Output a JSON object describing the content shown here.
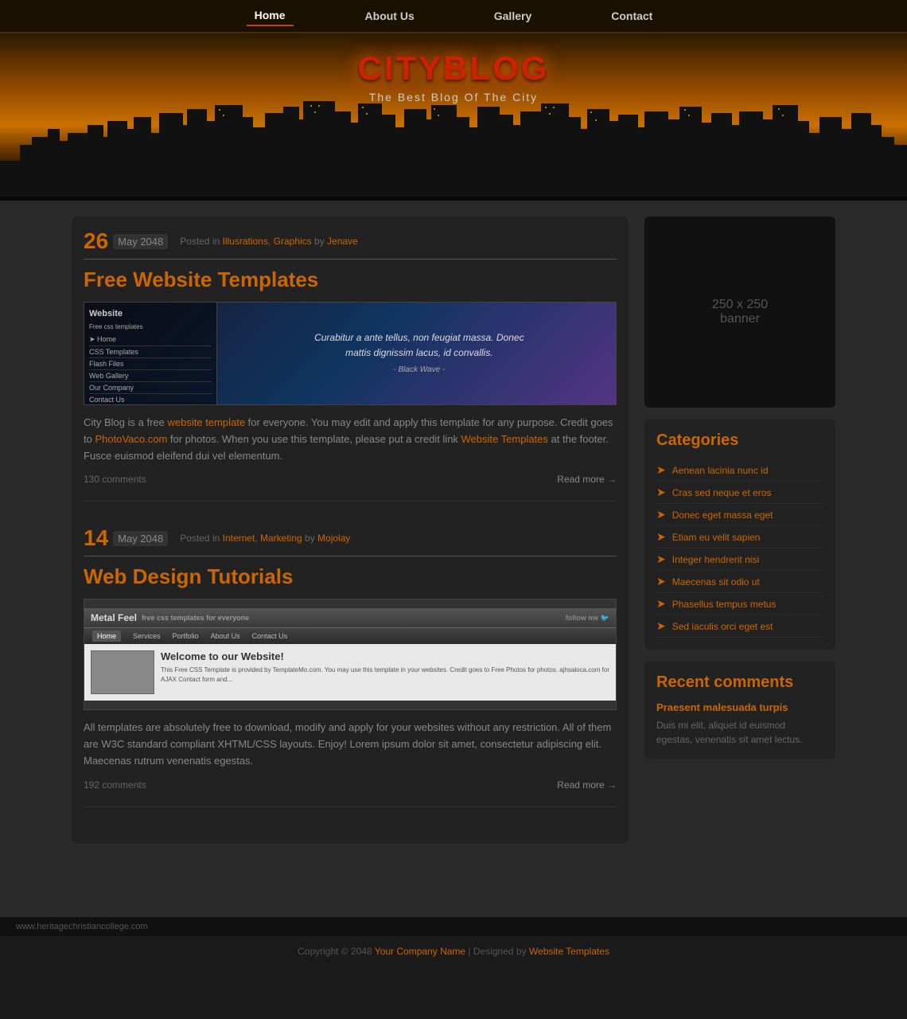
{
  "nav": {
    "items": [
      {
        "label": "Home",
        "active": true
      },
      {
        "label": "About Us",
        "active": false
      },
      {
        "label": "Gallery",
        "active": false
      },
      {
        "label": "Contact",
        "active": false
      }
    ]
  },
  "header": {
    "title": "CITYBLOG",
    "subtitle": "The Best Blog Of The City"
  },
  "posts": [
    {
      "date_num": "26",
      "date_month": "May 2048",
      "meta_prefix": "Posted in",
      "meta_categories": [
        "Illusrations",
        "Graphics"
      ],
      "meta_by": "by",
      "meta_author": "Jenave",
      "title": "Free Website Templates",
      "body": "City Blog is a free website template for everyone. You may edit and apply this template for any purpose. Credit goes to PhotoVaco.com for photos. When you use this template, please put a credit link Website Templates at the footer. Fusce euismod eleifend dui vel elementum.",
      "comments": "130 comments",
      "read_more": "Read more"
    },
    {
      "date_num": "14",
      "date_month": "May 2048",
      "meta_prefix": "Posted in",
      "meta_categories": [
        "Internet",
        "Marketing"
      ],
      "meta_by": "by",
      "meta_author": "Mojolay",
      "title": "Web Design Tutorials",
      "body": "All templates are absolutely free to download, modify and apply for your websites without any restriction. All of them are W3C standard compliant XHTML/CSS layouts. Enjoy! Lorem ipsum dolor sit amet, consectetur adipiscing elit. Maecenas rutrum venenatis egestas.",
      "comments": "192 comments",
      "read_more": "Read more"
    }
  ],
  "sidebar": {
    "banner": {
      "text": "250 x 250\nbanner"
    },
    "categories": {
      "title": "Categories",
      "items": [
        {
          "label": "Aenean lacinia nunc id"
        },
        {
          "label": "Cras sed neque et eros"
        },
        {
          "label": "Donec eget massa eget"
        },
        {
          "label": "Etiam eu velit sapien"
        },
        {
          "label": "Integer hendrerit nisi"
        },
        {
          "label": "Maecenas sit odio ut"
        },
        {
          "label": "Phasellus tempus metus"
        },
        {
          "label": "Sed iaculis orci eget est"
        }
      ]
    },
    "recent_comments": {
      "title": "Recent comments",
      "items": [
        {
          "name": "Praesent malesuada turpis",
          "text": "Duis mi elit, aliquet id euismod egestas, venenatis sit amet lectus."
        }
      ]
    }
  },
  "footer": {
    "url": "www.heritagechristiancollege.com",
    "copyright": "Copyright © 2048",
    "company_link": "Your Company Name",
    "designed_by": "| Designed by",
    "template_link": "Website Templates"
  },
  "post1_image": {
    "website_label": "Website",
    "free_css": "Free css templates",
    "nav_items": [
      "Home",
      "CSS Templates",
      "Flash Files",
      "Web Gallery",
      "Our Company",
      "Contact Us"
    ],
    "quote": "Curabitur a ante tellus, non feugiat massa. Donec mattis dignissim lacus, id convallis.",
    "quote_credit": "- Black Wave -"
  },
  "post2_image": {
    "brand": "Metal Feel",
    "tagline": "free css templates for everyone",
    "nav_items": [
      "Home",
      "Services",
      "Portfolio",
      "About Us",
      "Contact Us"
    ],
    "welcome": "Welcome to our Website!",
    "body_text": "This Free CSS Template is provided by TemplateMo.com. You may use this template in your websites. Credit goes to Free Photos for photos. ajhsaloca.com for AJAX Contact form and..."
  }
}
